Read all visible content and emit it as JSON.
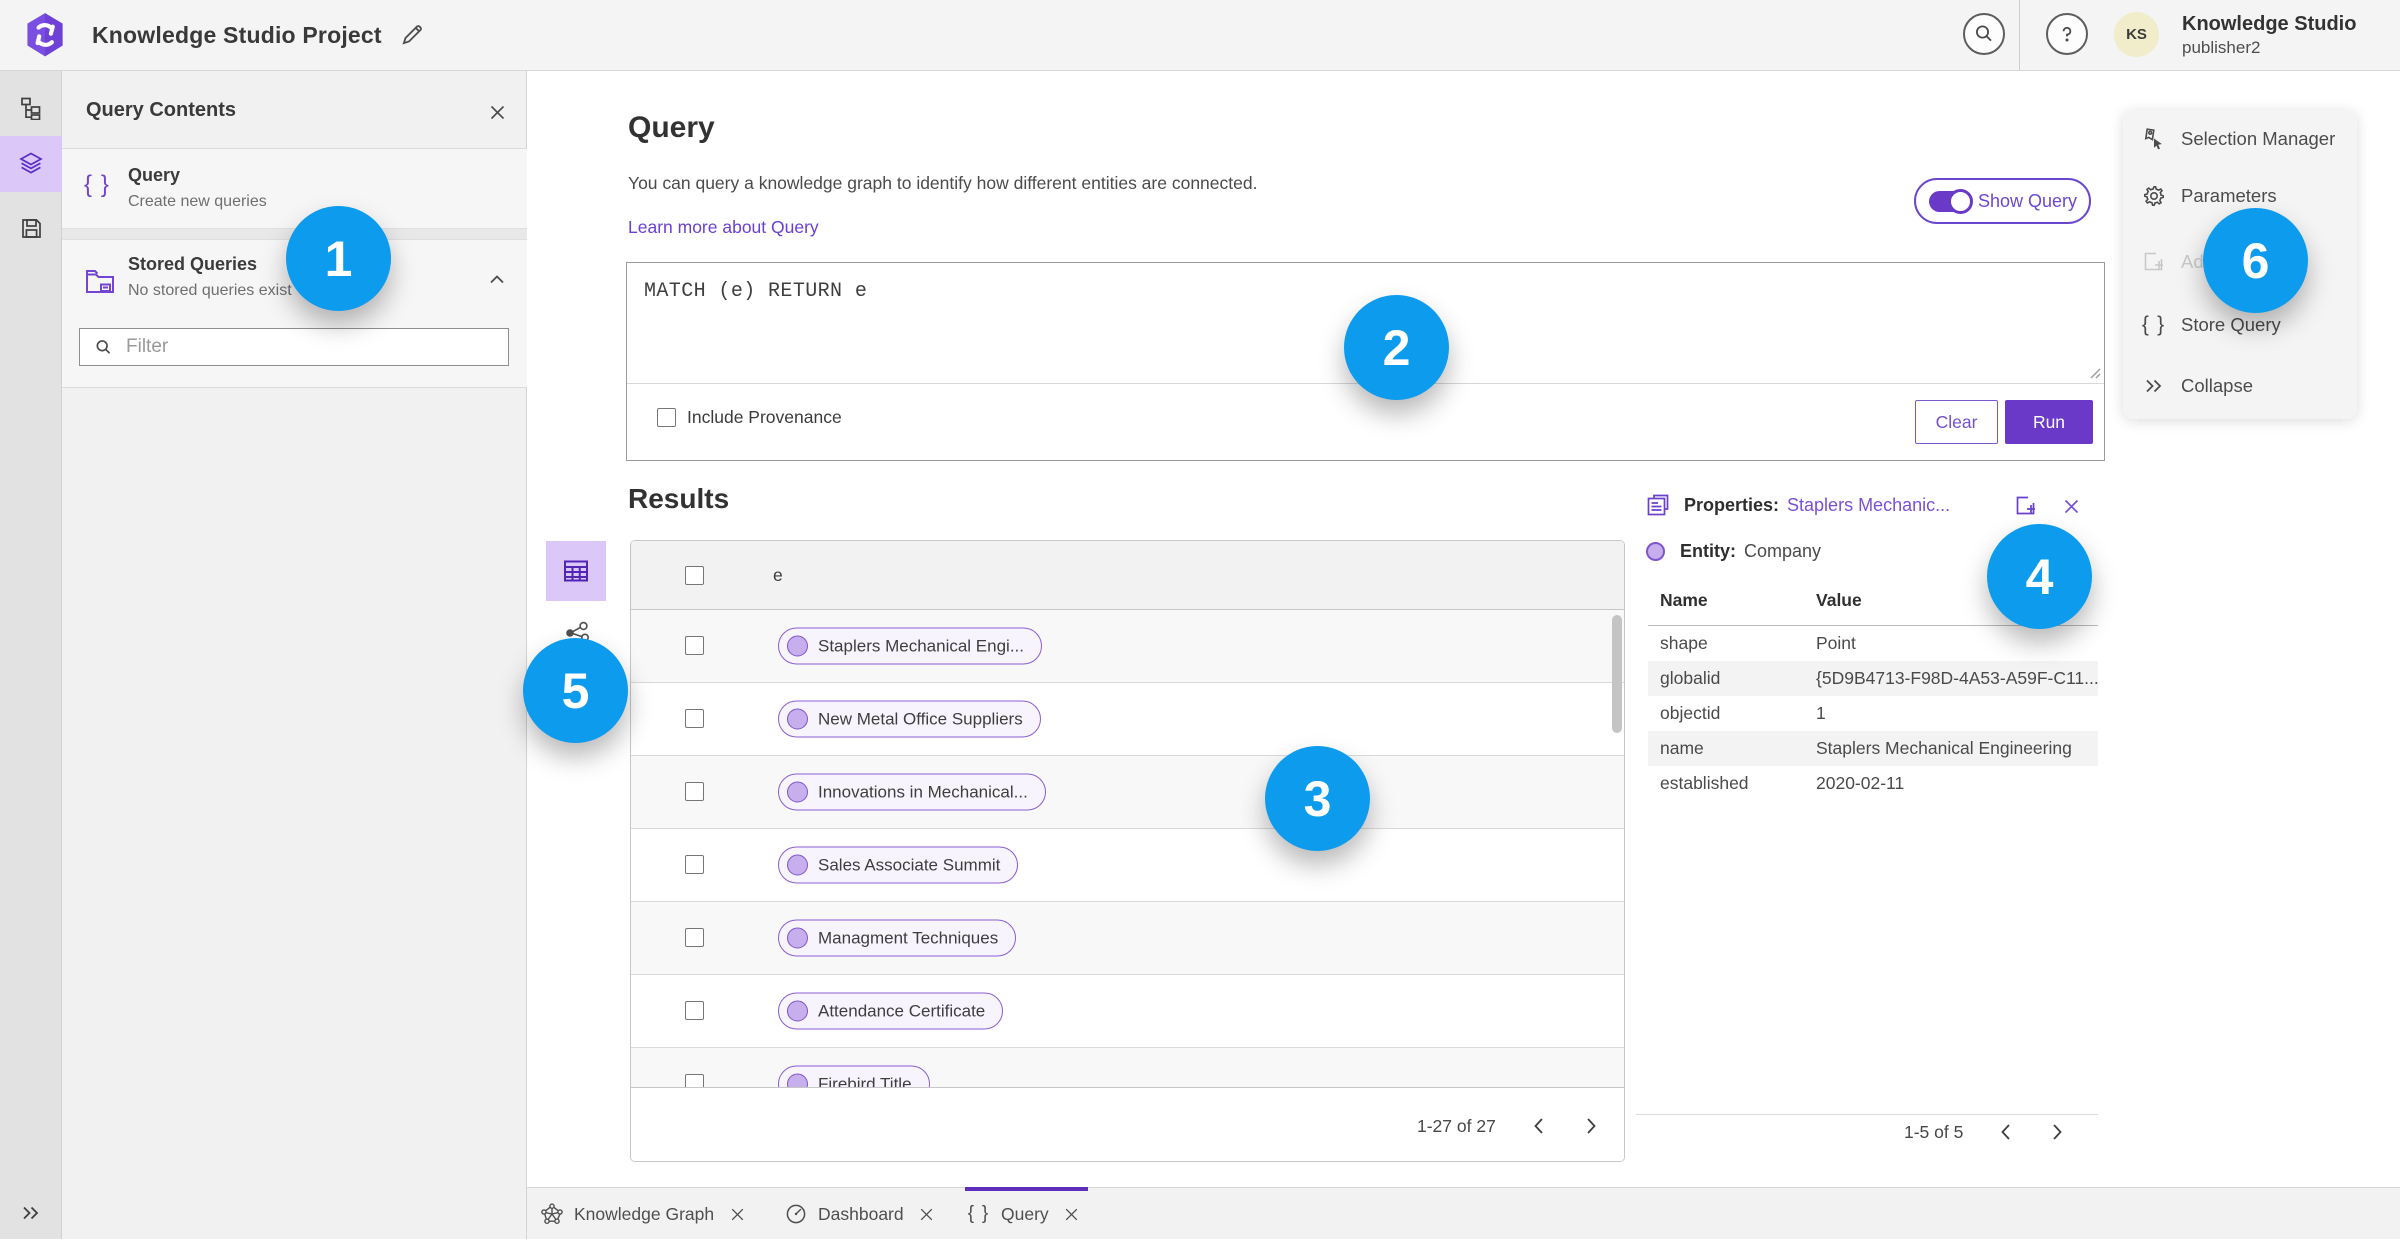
{
  "colors": {
    "accent": "#7445d2",
    "accent-strong": "#6a39c8",
    "link": "#6a40d4",
    "callout": "#0d9bee",
    "header-bg": "#f4f4f4",
    "rail-highlight": "#dbc7f8"
  },
  "header": {
    "app_title": "Knowledge Studio Project",
    "user_initials": "KS",
    "user_name": "Knowledge Studio",
    "user_role": "publisher2"
  },
  "sidebar": {
    "title": "Query Contents",
    "items": [
      {
        "label": "Query",
        "sublabel": "Create new queries"
      },
      {
        "label": "Stored Queries",
        "sublabel": "No stored queries exist"
      }
    ],
    "filter_placeholder": "Filter"
  },
  "query_panel": {
    "title": "Query",
    "description": "You can query a knowledge graph to identify how different entities are connected.",
    "learn_more": "Learn more about Query",
    "show_query_label": "Show Query",
    "query_text": "MATCH (e) RETURN e",
    "include_provenance": "Include Provenance",
    "clear_label": "Clear",
    "run_label": "Run"
  },
  "results": {
    "title": "Results",
    "column_header": "e",
    "rows": [
      "Staplers Mechanical Engi...",
      "New Metal Office Suppliers",
      "Innovations in Mechanical...",
      "Sales Associate Summit",
      "Managment Techniques",
      "Attendance Certificate",
      "Firebird Title"
    ],
    "pagination": "1-27 of 27"
  },
  "properties": {
    "title_prefix": "Properties:",
    "title_link": "Staplers Mechanic...",
    "entity_prefix": "Entity:",
    "entity_value": "Company",
    "col_name": "Name",
    "col_value": "Value",
    "rows": [
      {
        "name": "shape",
        "value": "Point"
      },
      {
        "name": "globalid",
        "value": "{5D9B4713-F98D-4A53-A59F-C11..."
      },
      {
        "name": "objectid",
        "value": "1"
      },
      {
        "name": "name",
        "value": "Staplers Mechanical Engineering"
      },
      {
        "name": "established",
        "value": "2020-02-11"
      }
    ],
    "pagination": "1-5 of 5"
  },
  "tools": {
    "items": [
      {
        "label": "Selection Manager"
      },
      {
        "label": "Parameters"
      },
      {
        "label": "Add To Map"
      },
      {
        "label": "Store Query"
      },
      {
        "label": "Collapse"
      }
    ]
  },
  "tabs": [
    {
      "label": "Knowledge Graph"
    },
    {
      "label": "Dashboard"
    },
    {
      "label": "Query"
    }
  ],
  "callouts": [
    "1",
    "2",
    "3",
    "4",
    "5",
    "6"
  ]
}
